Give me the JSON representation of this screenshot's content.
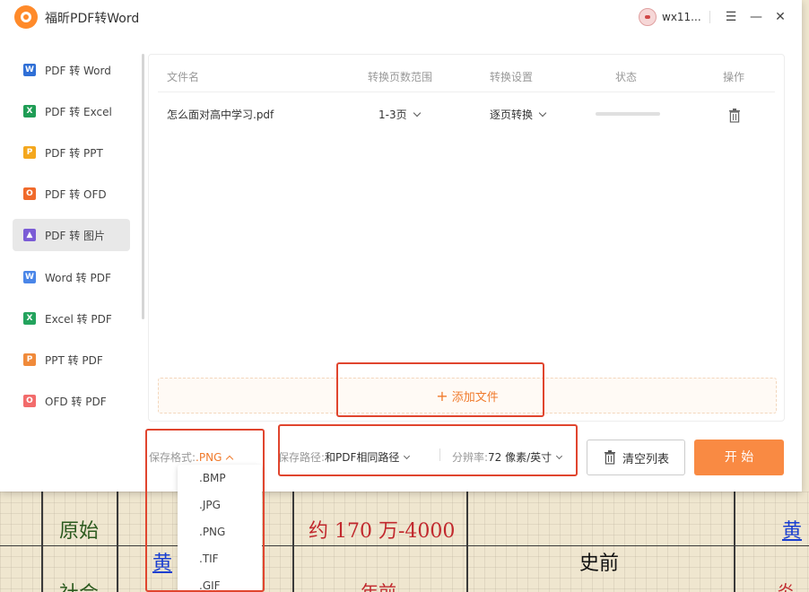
{
  "app": {
    "title": "福昕PDF转Word",
    "user_name": "wx11..."
  },
  "sidebar": {
    "items": [
      {
        "label": "PDF 转 Word",
        "icon": "word-icon",
        "badge": "W",
        "color": "#2f6fd6"
      },
      {
        "label": "PDF 转 Excel",
        "icon": "excel-icon",
        "badge": "X",
        "color": "#1f9d55"
      },
      {
        "label": "PDF 转 PPT",
        "icon": "ppt-icon",
        "badge": "P",
        "color": "#f4a71d"
      },
      {
        "label": "PDF 转 OFD",
        "icon": "ofd-icon",
        "badge": "O",
        "color": "#f06a2b"
      },
      {
        "label": "PDF 转 图片",
        "icon": "image-icon",
        "badge": "▲",
        "color": "#7b5cd6",
        "active": true
      },
      {
        "label": "Word 转 PDF",
        "icon": "word-to-pdf-icon",
        "badge": "W",
        "color": "#4a86e8"
      },
      {
        "label": "Excel 转 PDF",
        "icon": "excel-to-pdf-icon",
        "badge": "X",
        "color": "#23a35d"
      },
      {
        "label": "PPT 转 PDF",
        "icon": "ppt-to-pdf-icon",
        "badge": "P",
        "color": "#f08a3a"
      },
      {
        "label": "OFD 转 PDF",
        "icon": "ofd-to-pdf-icon",
        "badge": "O",
        "color": "#f26b6b"
      }
    ]
  },
  "table": {
    "headers": {
      "name": "文件名",
      "range": "转换页数范围",
      "settings": "转换设置",
      "status": "状态",
      "action": "操作"
    },
    "rows": [
      {
        "name": "怎么面对高中学习.pdf",
        "range": "1-3页",
        "settings": "逐页转换",
        "progress": 0
      }
    ]
  },
  "add_file": {
    "label": "添加文件"
  },
  "bottom": {
    "format_label": "保存格式:",
    "format_value": ".PNG",
    "path_label": "保存路径:",
    "path_value": "和PDF相同路径",
    "res_label": "分辨率:",
    "res_value": "72 像素/英寸",
    "clear_label": "清空列表",
    "start_label": "开 始"
  },
  "format_options": [
    ".BMP",
    ".JPG",
    ".PNG",
    ".TIF",
    ".GIF"
  ],
  "background_doc": {
    "cells": [
      "原始",
      "约 170 万-4000",
      "黄",
      "史前",
      "黄",
      "社会",
      "年前",
      "炎"
    ]
  },
  "colors": {
    "accent": "#f07b2d",
    "annotation": "#e0452e"
  }
}
